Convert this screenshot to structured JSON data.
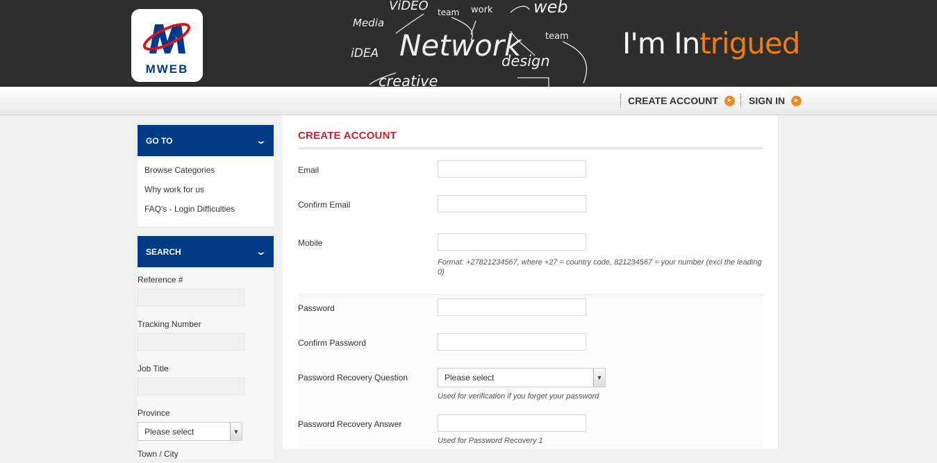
{
  "header": {
    "logo_text": "MWEB",
    "tagline_plain": "I'm In",
    "tagline_accent": "trigued",
    "chalk_words": [
      "ViDEO",
      "Media",
      "team",
      "work",
      "web",
      "team",
      "Network",
      "iDEA",
      "design",
      "creative"
    ]
  },
  "nav": {
    "create_account": "CREATE ACCOUNT",
    "sign_in": "SIGN IN"
  },
  "sidebar": {
    "goto_title": "GO TO",
    "goto_items": [
      "Browse Categories",
      "Why work for us",
      "FAQ's - Login Difficulties"
    ],
    "search_title": "SEARCH",
    "search_fields": {
      "reference": "Reference #",
      "tracking": "Tracking Number",
      "job_title": "Job Title",
      "province": "Province",
      "province_value": "Please select",
      "town": "Town / City"
    }
  },
  "main": {
    "title": "CREATE ACCOUNT",
    "email_label": "Email",
    "confirm_email_label": "Confirm Email",
    "mobile_label": "Mobile",
    "mobile_hint": "Format: +27821234567, where +27 = country code, 821234567 = your number (excl the leading 0)",
    "password_label": "Password",
    "confirm_password_label": "Confirm Password",
    "recovery_question_label": "Password Recovery Question",
    "recovery_question_value": "Please select",
    "recovery_question_hint": "Used for verification if you forget your password",
    "recovery_answer_label": "Password Recovery Answer",
    "recovery_answer_hint": "Used for Password Recovery 1"
  },
  "colors": {
    "brand_blue": "#003b85",
    "accent_orange": "#f07c10",
    "title_red": "#c8202f"
  },
  "icons": {
    "nav_arrow": "orange-circle-arrow-icon",
    "panel_toggle": "chevron-down-icon",
    "select_dropdown": "dropdown-arrow-icon"
  }
}
